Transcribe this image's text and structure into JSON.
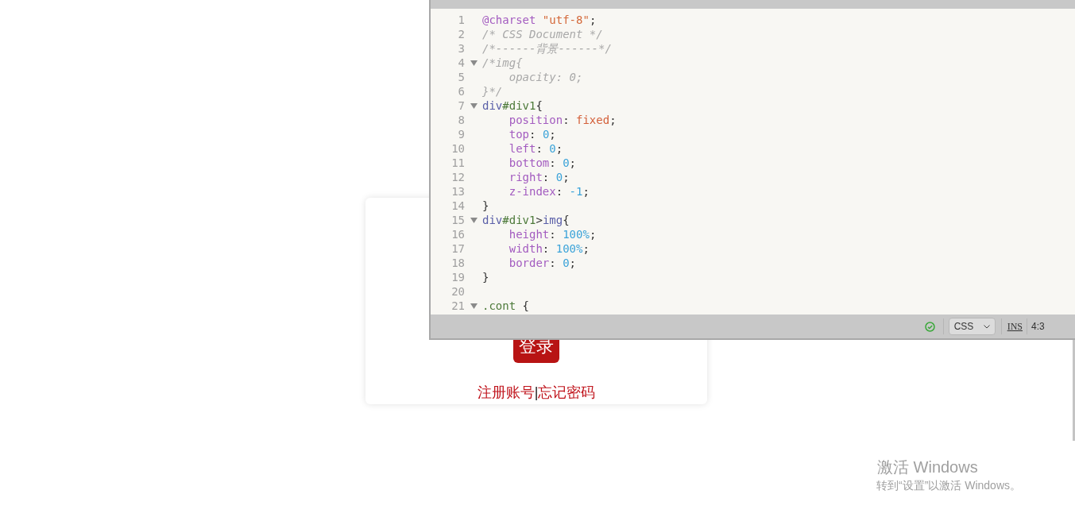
{
  "login_card": {
    "button": "登录",
    "links": [
      {
        "label": "注册账号"
      },
      {
        "label": "忘记密码"
      }
    ],
    "separator": "|"
  },
  "editor": {
    "lines": [
      {
        "number": "1",
        "kind": "plain",
        "tokens": [
          {
            "kind": "atrule",
            "text": "@charset"
          },
          {
            "kind": "string",
            "text": " \"utf-8\""
          },
          {
            "kind": "punct",
            "text": ";"
          }
        ]
      },
      {
        "number": "2",
        "kind": "plain",
        "tokens": [
          {
            "kind": "comment",
            "text": "/* CSS Document */"
          }
        ]
      },
      {
        "number": "3",
        "kind": "plain",
        "tokens": [
          {
            "kind": "comment",
            "text": "/*------背景------*/"
          }
        ]
      },
      {
        "number": "4",
        "kind": "fold",
        "tokens": [
          {
            "kind": "comment",
            "text": "/*img{"
          }
        ]
      },
      {
        "number": "5",
        "kind": "plain",
        "tokens": [
          {
            "kind": "comment",
            "text": "    opacity: 0;"
          }
        ]
      },
      {
        "number": "6",
        "kind": "plain",
        "tokens": [
          {
            "kind": "comment",
            "text": "}*/"
          }
        ]
      },
      {
        "number": "7",
        "kind": "fold",
        "tokens": [
          {
            "kind": "selector",
            "text": "div"
          },
          {
            "kind": "id",
            "text": "#div1"
          },
          {
            "kind": "punct",
            "text": "{"
          }
        ]
      },
      {
        "number": "8",
        "kind": "plain",
        "tokens": [
          {
            "kind": "property",
            "text": "    position"
          },
          {
            "kind": "punct",
            "text": ": "
          },
          {
            "kind": "keyword",
            "text": "fixed"
          },
          {
            "kind": "punct",
            "text": ";"
          }
        ]
      },
      {
        "number": "9",
        "kind": "plain",
        "tokens": [
          {
            "kind": "property",
            "text": "    top"
          },
          {
            "kind": "punct",
            "text": ": "
          },
          {
            "kind": "number",
            "text": "0"
          },
          {
            "kind": "punct",
            "text": ";"
          }
        ]
      },
      {
        "number": "10",
        "kind": "plain",
        "tokens": [
          {
            "kind": "property",
            "text": "    left"
          },
          {
            "kind": "punct",
            "text": ": "
          },
          {
            "kind": "number",
            "text": "0"
          },
          {
            "kind": "punct",
            "text": ";"
          }
        ]
      },
      {
        "number": "11",
        "kind": "plain",
        "tokens": [
          {
            "kind": "property",
            "text": "    bottom"
          },
          {
            "kind": "punct",
            "text": ": "
          },
          {
            "kind": "number",
            "text": "0"
          },
          {
            "kind": "punct",
            "text": ";"
          }
        ]
      },
      {
        "number": "12",
        "kind": "plain",
        "tokens": [
          {
            "kind": "property",
            "text": "    right"
          },
          {
            "kind": "punct",
            "text": ": "
          },
          {
            "kind": "number",
            "text": "0"
          },
          {
            "kind": "punct",
            "text": ";"
          }
        ]
      },
      {
        "number": "13",
        "kind": "plain",
        "tokens": [
          {
            "kind": "property",
            "text": "    z-index"
          },
          {
            "kind": "punct",
            "text": ": "
          },
          {
            "kind": "number",
            "text": "-1"
          },
          {
            "kind": "punct",
            "text": ";"
          }
        ]
      },
      {
        "number": "14",
        "kind": "plain",
        "tokens": [
          {
            "kind": "punct",
            "text": "}"
          }
        ]
      },
      {
        "number": "15",
        "kind": "fold",
        "tokens": [
          {
            "kind": "selector",
            "text": "div"
          },
          {
            "kind": "id",
            "text": "#div1"
          },
          {
            "kind": "punct",
            "text": ">"
          },
          {
            "kind": "selector",
            "text": "img"
          },
          {
            "kind": "punct",
            "text": "{"
          }
        ]
      },
      {
        "number": "16",
        "kind": "plain",
        "tokens": [
          {
            "kind": "property",
            "text": "    height"
          },
          {
            "kind": "punct",
            "text": ": "
          },
          {
            "kind": "number",
            "text": "100%"
          },
          {
            "kind": "punct",
            "text": ";"
          }
        ]
      },
      {
        "number": "17",
        "kind": "plain",
        "tokens": [
          {
            "kind": "property",
            "text": "    width"
          },
          {
            "kind": "punct",
            "text": ": "
          },
          {
            "kind": "number",
            "text": "100%"
          },
          {
            "kind": "punct",
            "text": ";"
          }
        ]
      },
      {
        "number": "18",
        "kind": "plain",
        "tokens": [
          {
            "kind": "property",
            "text": "    border"
          },
          {
            "kind": "punct",
            "text": ": "
          },
          {
            "kind": "number",
            "text": "0"
          },
          {
            "kind": "punct",
            "text": ";"
          }
        ]
      },
      {
        "number": "19",
        "kind": "plain",
        "tokens": [
          {
            "kind": "punct",
            "text": "}"
          }
        ]
      },
      {
        "number": "20",
        "kind": "plain"
      },
      {
        "number": "21",
        "kind": "fold",
        "tokens": [
          {
            "kind": "id",
            "text": ".cont"
          },
          {
            "kind": "punct",
            "text": " {"
          }
        ]
      }
    ],
    "status_bar": {
      "language": "CSS",
      "mode": "INS",
      "position": "4:3"
    }
  },
  "activation": {
    "title": "激活 Windows",
    "message": "转到“设置”以激活 Windows。"
  }
}
